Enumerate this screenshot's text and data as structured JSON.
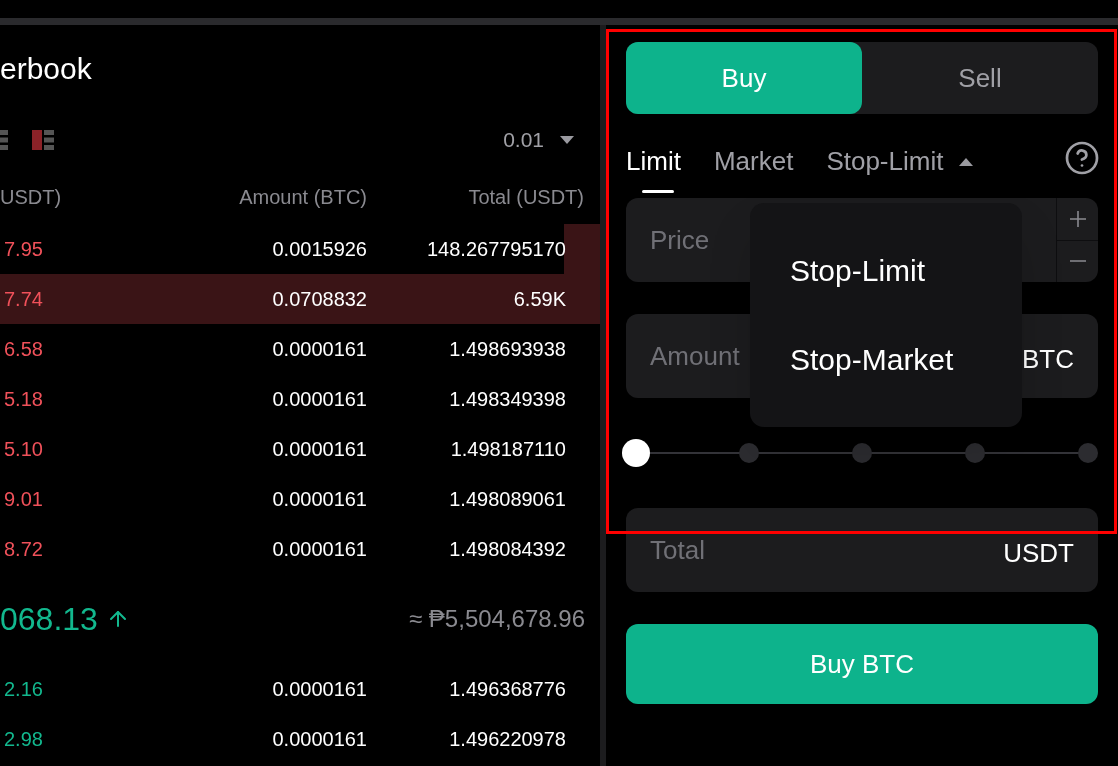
{
  "orderbook": {
    "title": "erbook",
    "precision": "0.01",
    "columns": [
      "USDT)",
      "Amount (BTC)",
      "Total (USDT)"
    ],
    "asks": [
      {
        "price": "7.95",
        "amount": "0.0015926",
        "total": "148.267795170",
        "highlighted": false,
        "level": 0.06
      },
      {
        "price": "7.74",
        "amount": "0.0708832",
        "total": "6.59K",
        "highlighted": true
      },
      {
        "price": "6.58",
        "amount": "0.0000161",
        "total": "1.498693938",
        "highlighted": false
      },
      {
        "price": "5.18",
        "amount": "0.0000161",
        "total": "1.498349398",
        "highlighted": false
      },
      {
        "price": "5.10",
        "amount": "0.0000161",
        "total": "1.498187110",
        "highlighted": false
      },
      {
        "price": "9.01",
        "amount": "0.0000161",
        "total": "1.498089061",
        "highlighted": false
      },
      {
        "price": "8.72",
        "amount": "0.0000161",
        "total": "1.498084392",
        "highlighted": false
      }
    ],
    "last_price": {
      "value": "068.13",
      "converted": "≈ ₱5,504,678.96"
    },
    "bids": [
      {
        "price": "2.16",
        "amount": "0.0000161",
        "total": "1.496368776",
        "highlighted": false
      },
      {
        "price": "2.98",
        "amount": "0.0000161",
        "total": "1.496220978",
        "highlighted": false
      }
    ]
  },
  "trade": {
    "sides": [
      {
        "label": "Buy",
        "selected": true
      },
      {
        "label": "Sell",
        "selected": false
      }
    ],
    "order_types": [
      {
        "label": "Limit",
        "selected": true,
        "kind": "tab"
      },
      {
        "label": "Market",
        "selected": false,
        "kind": "tab"
      },
      {
        "label": "Stop-Limit",
        "selected": false,
        "kind": "dropdown",
        "expanded": true
      }
    ],
    "dropdown_options": [
      "Stop-Limit",
      "Stop-Market"
    ],
    "price_field": {
      "placeholder": "Price"
    },
    "amount_field": {
      "placeholder": "Amount",
      "unit": "BTC"
    },
    "slider": {
      "level": 0
    },
    "total_field": {
      "placeholder": "Total",
      "unit": "USDT"
    },
    "submit": "Buy BTC",
    "highlighted": true
  }
}
